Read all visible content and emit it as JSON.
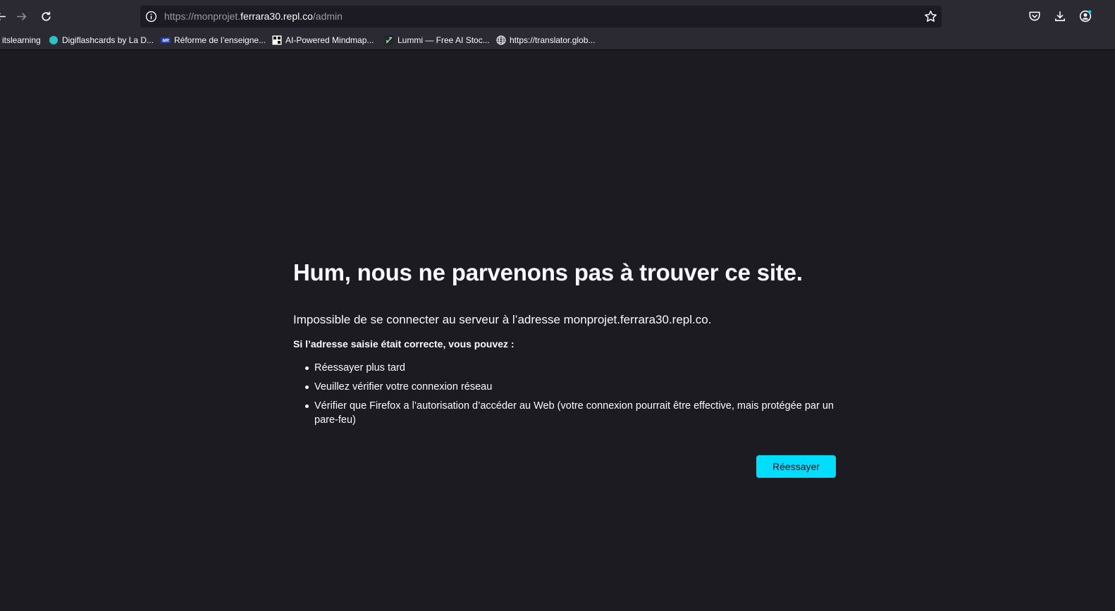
{
  "browser": {
    "url_prefix": "https://monprojet.",
    "url_host": "ferrara30.repl.co",
    "url_suffix": "/admin",
    "accent": "#00ddff"
  },
  "bookmarks": [
    {
      "label": "itslearning",
      "icon": "none"
    },
    {
      "label": "Digiflashcards by La D...",
      "icon": "teal-circle-icon"
    },
    {
      "label": "Réforme de l’enseigne...",
      "icon": "mr-logo-icon"
    },
    {
      "label": "AI-Powered Mindmap...",
      "icon": "mindmap-icon"
    },
    {
      "label": "Lummi — Free AI Stoc...",
      "icon": "lummi-icon"
    },
    {
      "label": "https://translator.glob...",
      "icon": "globe-icon"
    }
  ],
  "error": {
    "title": "Hum, nous ne parvenons pas à trouver ce site.",
    "description": "Impossible de se connecter au serveur à l’adresse monprojet.ferrara30.repl.co.",
    "subtitle": "Si l’adresse saisie était correcte, vous pouvez :",
    "items": [
      "Réessayer plus tard",
      "Veuillez vérifier votre connexion réseau",
      "Vérifier que Firefox a l’autorisation d’accéder au Web (votre connexion pourrait être effective, mais protégée par un pare-feu)"
    ],
    "retry_label": "Réessayer"
  }
}
